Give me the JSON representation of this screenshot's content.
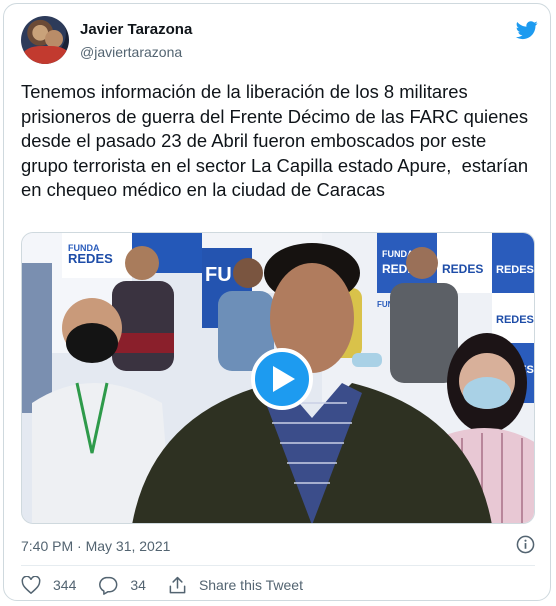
{
  "tweet": {
    "author_name": "Javier Tarazona",
    "author_handle": "@javiertarazona",
    "text": "Tenemos información de la liberación de los 8 militares prisioneros de guerra del Frente Décimo de las FARC quienes desde el pasado 23 de Abril fueron emboscados por este grupo terrorista en el sector La Capilla estado Apure,  estarían en chequeo médico en la ciudad de Caracas",
    "timestamp": "7:40 PM · May 31, 2021",
    "likes": "344",
    "replies": "34",
    "share_label": "Share this Tweet"
  },
  "media": {
    "backdrop_texts": [
      "FUNDA",
      "REDES",
      "FUNDA",
      "REDES",
      "FU",
      "REDES",
      "REDES",
      "REDES",
      "FUNDA",
      "REDES"
    ]
  },
  "icons": {
    "brand": "twitter-bird-icon",
    "play": "play-icon",
    "info": "info-icon",
    "like": "heart-icon",
    "reply": "reply-bubble-icon",
    "share": "share-icon"
  },
  "colors": {
    "accent": "#1d9bf0",
    "text": "#0f1419",
    "muted": "#536471",
    "border": "#cfd9de"
  }
}
